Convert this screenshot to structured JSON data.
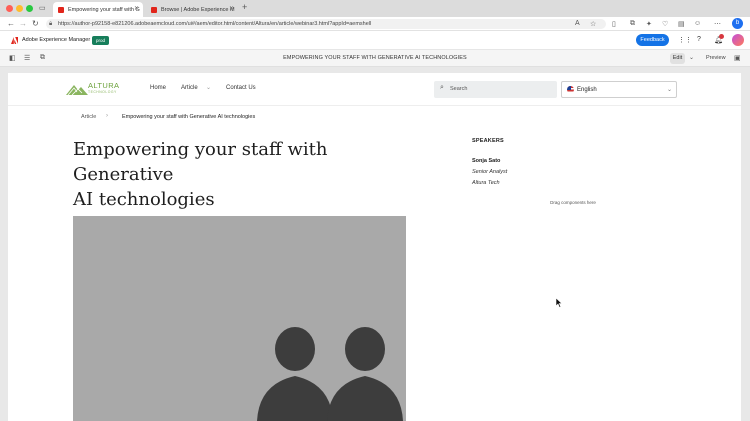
{
  "browser": {
    "tabs": [
      {
        "title": "Empowering your staff with G",
        "active": true
      },
      {
        "title": "Browse | Adobe Experience M",
        "active": false
      }
    ],
    "new_tab": "+",
    "url": "https://author-p92158-e821206.adobeaemcloud.com/ui#/aem/editor.html/content/Altura/en/article/webinar3.html?appId=aemshell"
  },
  "aem": {
    "title": "Adobe Experience Manager",
    "badge": "prod",
    "feedback": "Feedback"
  },
  "editor": {
    "page_title": "EMPOWERING YOUR STAFF WITH GENERATIVE AI TECHNOLOGIES",
    "mode": "Edit",
    "preview": "Preview"
  },
  "site": {
    "logo": {
      "name": "ALTURA",
      "sub": "TECHNOLOGY"
    },
    "nav": {
      "home": "Home",
      "article": "Article",
      "contact": "Contact Us"
    },
    "search_placeholder": "Search",
    "language": "English"
  },
  "breadcrumb": {
    "parent": "Article",
    "current": "Empowering your staff with Generative AI technologies"
  },
  "article": {
    "title_line1": "Empowering your staff with Generative",
    "title_line2": "AI technologies"
  },
  "speakers": {
    "heading": "SPEAKERS",
    "name": "Sonja Sato",
    "role": "Senior Analyst",
    "org": "Altura Tech",
    "placeholder": "Drag components here"
  },
  "colors": {
    "accent": "#1473e6",
    "brand": "#6ba13a",
    "badge": "#177e5b",
    "hero_bg": "#a9a9a9"
  }
}
